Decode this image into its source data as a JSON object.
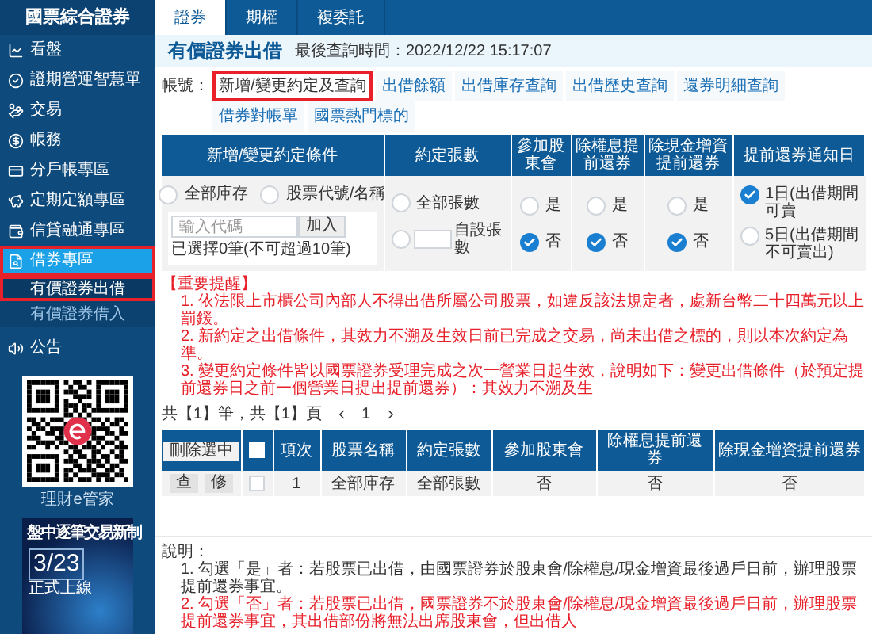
{
  "brand": "國票綜合證券",
  "sidebar": {
    "items": [
      {
        "label": "看盤",
        "selected": false,
        "highlighted": false
      },
      {
        "label": "證期營運智慧單",
        "selected": false,
        "highlighted": false
      },
      {
        "label": "交易",
        "selected": false,
        "highlighted": false
      },
      {
        "label": "帳務",
        "selected": false,
        "highlighted": false
      },
      {
        "label": "分戶帳專區",
        "selected": false,
        "highlighted": false
      },
      {
        "label": "定期定額專區",
        "selected": false,
        "highlighted": false
      },
      {
        "label": "信貸融通專區",
        "selected": false,
        "highlighted": false
      },
      {
        "label": "借券專區",
        "selected": true,
        "highlighted": true,
        "children": [
          {
            "label": "有價證券出借",
            "selected": true,
            "highlighted": true
          },
          {
            "label": "有價證券借入",
            "selected": false,
            "highlighted": false
          }
        ]
      },
      {
        "label": "公告",
        "selected": false,
        "highlighted": false
      }
    ]
  },
  "qr": {
    "caption": "理財e管家"
  },
  "banner": {
    "headline": "盤中逐筆交易新制",
    "date": "3/23",
    "subline": "正式上線"
  },
  "top_tabs": [
    {
      "label": "證券",
      "selected": true
    },
    {
      "label": "期權",
      "selected": false
    },
    {
      "label": "複委託",
      "selected": false
    }
  ],
  "page": {
    "title": "有價證券出借",
    "last_query": "最後查詢時間：2022/12/22 15:17:07"
  },
  "account_label": "帳號：",
  "sub_tabs": [
    {
      "label": "新增/變更約定及查詢",
      "selected": true,
      "highlighted": true
    },
    {
      "label": "出借餘額",
      "selected": false,
      "highlighted": false
    },
    {
      "label": "出借庫存查詢",
      "selected": false,
      "highlighted": false
    },
    {
      "label": "出借歷史查詢",
      "selected": false,
      "highlighted": false
    },
    {
      "label": "還券明細查詢",
      "selected": false,
      "highlighted": false
    },
    {
      "label": "借券對帳單",
      "selected": false,
      "highlighted": false
    },
    {
      "label": "國票熱門標的",
      "selected": false,
      "highlighted": false
    }
  ],
  "form": {
    "columns": [
      "新增/變更約定條件",
      "約定張數",
      "參加股東會",
      "除權息提前還券",
      "除現金增資提前還券",
      "提前還券通知日"
    ],
    "scope_options": [
      {
        "label": "全部庫存",
        "selected": false
      },
      {
        "label": "股票代號/名稱",
        "selected": false
      }
    ],
    "code_input": {
      "placeholder": "輸入代碼"
    },
    "add_button": "加入",
    "selected_count": "已選擇0筆(不可超過10筆)",
    "qty_options": [
      {
        "label": "全部張數",
        "selected": false
      },
      {
        "label": "自設張數",
        "selected": false
      }
    ],
    "yes_no": [
      [
        {
          "label": "是",
          "selected": false
        },
        {
          "label": "否",
          "selected": true
        }
      ],
      [
        {
          "label": "是",
          "selected": false
        },
        {
          "label": "否",
          "selected": true
        }
      ],
      [
        {
          "label": "是",
          "selected": false
        },
        {
          "label": "否",
          "selected": true
        }
      ]
    ],
    "notice_options": [
      {
        "label": "1日(出借期間可賣",
        "selected": true
      },
      {
        "label": "5日(出借期間不可賣出)",
        "selected": false
      }
    ]
  },
  "notices": {
    "heading": "【重要提醒】",
    "items": [
      "1. 依法限上市櫃公司內部人不得出借所屬公司股票，如違反該法規定者，處新台幣二十四萬元以上罰鍰。",
      "2. 新約定之出借條件，其效力不溯及生效日前已完成之交易，尚未出借之標的，則以本次約定為準。",
      "3. 變更約定條件皆以國票證券受理完成之次一營業日起生效，說明如下：變更出借條件（於預定提前還券日之前一個營業日提出提前還券）：其效力不溯及生"
    ]
  },
  "pager": {
    "summary": "共【1】筆，共【1】頁",
    "page": "1"
  },
  "results": {
    "delete_button": "刪除選中",
    "select_all_checked": false,
    "columns": [
      "項次",
      "股票名稱",
      "約定張數",
      "參加股東會",
      "除權息提前還券",
      "除現金增資提前還券"
    ],
    "rows": [
      {
        "query": "查",
        "edit": "修",
        "checked": false,
        "cells": [
          "1",
          "全部庫存",
          "全部張數",
          "否",
          "否",
          "否"
        ]
      }
    ]
  },
  "notes": {
    "heading": "說明：",
    "items": [
      {
        "text": "1. 勾選「是」者：若股票已出借，由國票證券於股東會/除權息/現金增資最後過戶日前，辦理股票提前還券事宜。",
        "emphasis": false
      },
      {
        "text": "2. 勾選「否」者：若股票已出借，國票證券不於股東會/除權息/現金增資最後過戶日前，辦理股票提前還券事宜，其出借部份將無法出席股東會，但出借人",
        "emphasis": true
      }
    ]
  }
}
